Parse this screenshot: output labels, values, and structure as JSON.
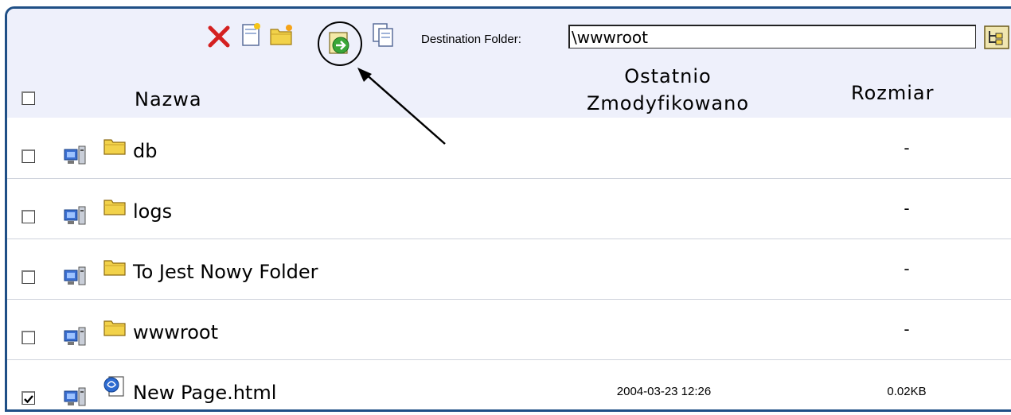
{
  "toolbar": {
    "icons": [
      "delete-icon",
      "new-file-icon",
      "new-folder-icon",
      "move-icon",
      "copy-icon"
    ],
    "destination_label": "Destination Folder:",
    "destination_value": "\\wwwroot",
    "browse_icon": "folder-tree-icon"
  },
  "columns": {
    "name": "Nazwa",
    "modified_line1": "Ostatnio",
    "modified_line2": "Zmodyfikowano",
    "size": "Rozmiar"
  },
  "rows": [
    {
      "name": "db",
      "type": "folder",
      "modified": "",
      "size": "-",
      "checked": false
    },
    {
      "name": "logs",
      "type": "folder",
      "modified": "",
      "size": "-",
      "checked": false
    },
    {
      "name": "To Jest Nowy Folder",
      "type": "folder",
      "modified": "",
      "size": "-",
      "checked": false
    },
    {
      "name": "wwwroot",
      "type": "folder",
      "modified": "",
      "size": "-",
      "checked": false
    },
    {
      "name": "New Page.html",
      "type": "file",
      "modified": "2004-03-23 12:26",
      "size": "0.02KB",
      "checked": true
    }
  ],
  "colors": {
    "border": "#1f4f86",
    "header_bg": "#eef0fb",
    "delete_red": "#d42020",
    "folder_yellow": "#f2d24a"
  }
}
